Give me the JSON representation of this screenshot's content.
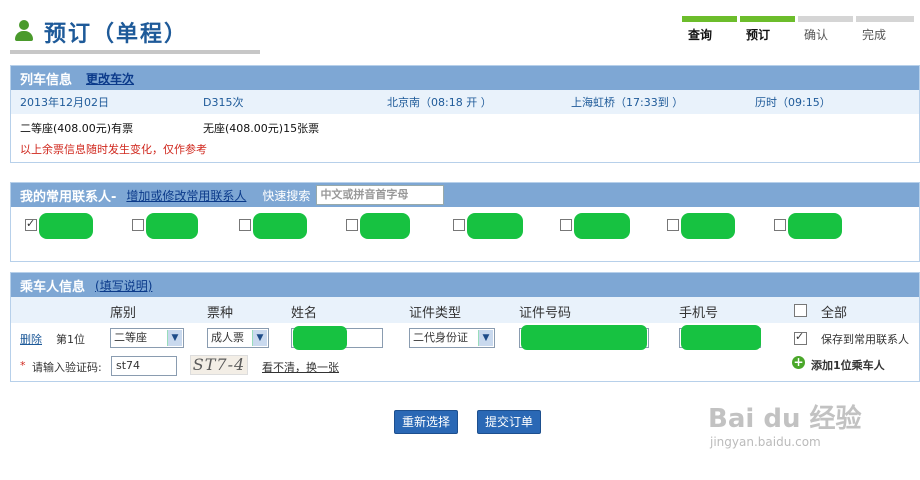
{
  "header": {
    "title": "预订（单程）",
    "steps": [
      {
        "label": "查询",
        "active": true
      },
      {
        "label": "预订",
        "active": true
      },
      {
        "label": "确认",
        "active": false
      },
      {
        "label": "完成",
        "active": false
      }
    ]
  },
  "train_section": {
    "heading": "列车信息",
    "change_link": "更改车次",
    "date": "2013年12月02日",
    "train_no": "D315次",
    "from": "北京南（08:18 开 ）",
    "to": "上海虹桥（17:33到 ）",
    "duration": "历时（09:15）",
    "ticket_1": "二等座(408.00元)有票",
    "ticket_2": "无座(408.00元)15张票",
    "warning": "以上余票信息随时发生变化，仅作参考"
  },
  "contacts_section": {
    "heading": "我的常用联系人-",
    "edit_link": "增加或修改常用联系人",
    "search_label": "快速搜索",
    "search_placeholder": "中文或拼音首字母",
    "contacts": [
      {
        "checked": true
      },
      {
        "checked": false
      },
      {
        "checked": false
      },
      {
        "checked": false
      },
      {
        "checked": false
      },
      {
        "checked": false
      },
      {
        "checked": false
      },
      {
        "checked": false
      }
    ]
  },
  "passenger_section": {
    "heading": "乘车人信息",
    "help_link": "(填写说明)",
    "columns": {
      "seat": "席别",
      "ticket_type": "票种",
      "name": "姓名",
      "id_type": "证件类型",
      "id_no": "证件号码",
      "phone": "手机号",
      "all": "全部"
    },
    "row": {
      "delete": "删除",
      "position": "第1位",
      "seat_value": "二等座",
      "ticket_value": "成人票",
      "id_type_value": "二代身份证",
      "save_label": "保存到常用联系人"
    },
    "captcha": {
      "required_mark": "*",
      "label": "请输入验证码:",
      "value": "st74",
      "image_text": "ST7-4",
      "refresh_link": "看不清，换一张"
    },
    "add_passenger": "添加1位乘车人"
  },
  "buttons": {
    "reselect": "重新选择",
    "submit": "提交订单"
  },
  "watermark": {
    "brand": "Bai du 经验",
    "url": "jingyan.baidu.com"
  },
  "colors": {
    "accent_blue": "#7ea7d4",
    "title_blue": "#1e5a99",
    "step_green": "#6cbd2b",
    "warning_red": "#d0281e",
    "redaction_green": "#17c241"
  }
}
